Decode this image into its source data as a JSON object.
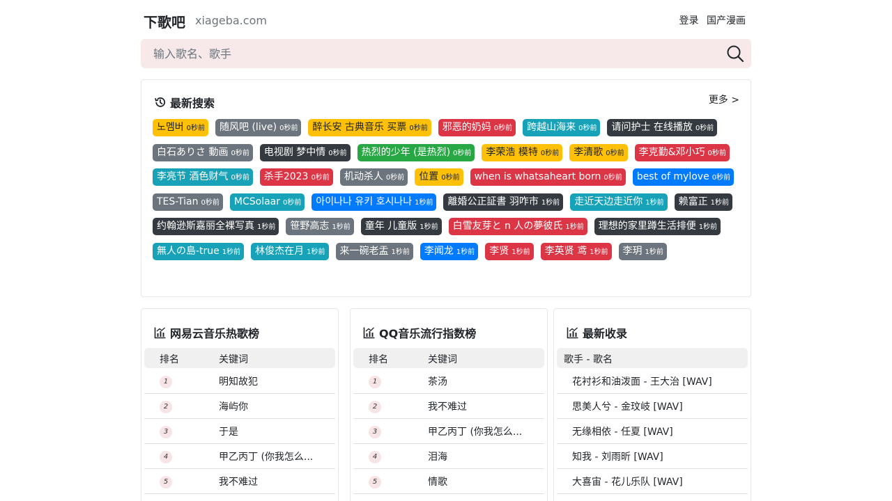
{
  "header": {
    "logo": "下歌吧",
    "domain": "xiageba.com",
    "nav": [
      "登录",
      "国产漫画"
    ]
  },
  "search": {
    "placeholder": "输入歌名、歌手",
    "icon": "search-icon"
  },
  "recent": {
    "title": "最新搜索",
    "more": "更多 >",
    "icon": "history-icon",
    "tags": [
      {
        "text": "노멤버",
        "time": "0秒前",
        "color": "yellow"
      },
      {
        "text": "随风吧 (live)",
        "time": "0秒前",
        "color": "gray"
      },
      {
        "text": "醉长安 古典音乐 买票",
        "time": "0秒前",
        "color": "yellow"
      },
      {
        "text": "邪恶的奶妈",
        "time": "0秒前",
        "color": "red"
      },
      {
        "text": "跨越山海来",
        "time": "0秒前",
        "color": "teal"
      },
      {
        "text": "请问护士 在线播放",
        "time": "0秒前",
        "color": "dark"
      },
      {
        "text": "白石ありさ 動画",
        "time": "0秒前",
        "color": "gray"
      },
      {
        "text": "电视剧 梦中情",
        "time": "0秒前",
        "color": "dark"
      },
      {
        "text": "热烈的少年 (是热烈)",
        "time": "0秒前",
        "color": "green"
      },
      {
        "text": "李荣浩 模特",
        "time": "0秒前",
        "color": "yellow"
      },
      {
        "text": "李清歌",
        "time": "0秒前",
        "color": "yellow"
      },
      {
        "text": "李克勤&邓小巧",
        "time": "0秒前",
        "color": "red"
      },
      {
        "text": "李亮节 酒色财气",
        "time": "0秒前",
        "color": "teal"
      },
      {
        "text": "杀手2023",
        "time": "0秒前",
        "color": "red"
      },
      {
        "text": "机动杀人",
        "time": "0秒前",
        "color": "gray"
      },
      {
        "text": "位置",
        "time": "0秒前",
        "color": "yellow"
      },
      {
        "text": "when is whatsaheart born",
        "time": "0秒前",
        "color": "red"
      },
      {
        "text": "best of mylove",
        "time": "0秒前",
        "color": "blue"
      },
      {
        "text": "TES-Tian",
        "time": "0秒前",
        "color": "gray"
      },
      {
        "text": "MCSolaar",
        "time": "0秒前",
        "color": "teal"
      },
      {
        "text": "아이나나 유키 호시나나",
        "time": "1秒前",
        "color": "blue"
      },
      {
        "text": "離婚公正証書 羽咋市",
        "time": "1秒前",
        "color": "dark"
      },
      {
        "text": "走近天边走近你",
        "time": "1秒前",
        "color": "teal"
      },
      {
        "text": "赖富正",
        "time": "1秒前",
        "color": "dark"
      },
      {
        "text": "约翰逊斯嘉丽全裸写真",
        "time": "1秒前",
        "color": "dark"
      },
      {
        "text": "笹野高志",
        "time": "1秒前",
        "color": "gray"
      },
      {
        "text": "童年 儿童版",
        "time": "1秒前",
        "color": "dark"
      },
      {
        "text": "白雪友芽と n 人の夢彼氏",
        "time": "1秒前",
        "color": "red"
      },
      {
        "text": "理想的家里蹲生活排便",
        "time": "1秒前",
        "color": "dark"
      },
      {
        "text": "無人の島-true",
        "time": "1秒前",
        "color": "teal"
      },
      {
        "text": "林俊杰在月",
        "time": "1秒前",
        "color": "teal"
      },
      {
        "text": "来一碗老盂",
        "time": "1秒前",
        "color": "gray"
      },
      {
        "text": "李闻龙",
        "time": "1秒前",
        "color": "blue"
      },
      {
        "text": "李贤",
        "time": "1秒前",
        "color": "red"
      },
      {
        "text": "李英贤 鸢",
        "time": "1秒前",
        "color": "red"
      },
      {
        "text": "李玥",
        "time": "1秒前",
        "color": "gray"
      }
    ]
  },
  "netease": {
    "title": "网易云音乐热歌榜",
    "icon": "chart-icon",
    "col_rank": "排名",
    "col_keyword": "关键词",
    "rows": [
      {
        "rank": "1",
        "keyword": "明知故犯"
      },
      {
        "rank": "2",
        "keyword": "海屿你"
      },
      {
        "rank": "3",
        "keyword": "于是"
      },
      {
        "rank": "4",
        "keyword": "甲乙丙丁 (你我怎么..."
      },
      {
        "rank": "5",
        "keyword": "我不难过"
      }
    ]
  },
  "qq": {
    "title": "QQ音乐流行指数榜",
    "icon": "chart-icon",
    "col_rank": "排名",
    "col_keyword": "关键词",
    "rows": [
      {
        "rank": "1",
        "keyword": "茶汤"
      },
      {
        "rank": "2",
        "keyword": "我不难过"
      },
      {
        "rank": "3",
        "keyword": "甲乙丙丁 (你我怎么..."
      },
      {
        "rank": "4",
        "keyword": "泪海"
      },
      {
        "rank": "5",
        "keyword": "情歌"
      }
    ]
  },
  "latest": {
    "title": "最新收录",
    "icon": "chart-icon",
    "col": "歌手 - 歌名",
    "rows": [
      "花衬衫和油泼面 - 王大治 [WAV]",
      "思美人兮 - 金玟岐 [WAV]",
      "无缘相依 - 任夏 [WAV]",
      "知我 - 刘雨昕 [WAV]",
      "大喜宙 - 花儿乐队 [WAV]"
    ]
  }
}
